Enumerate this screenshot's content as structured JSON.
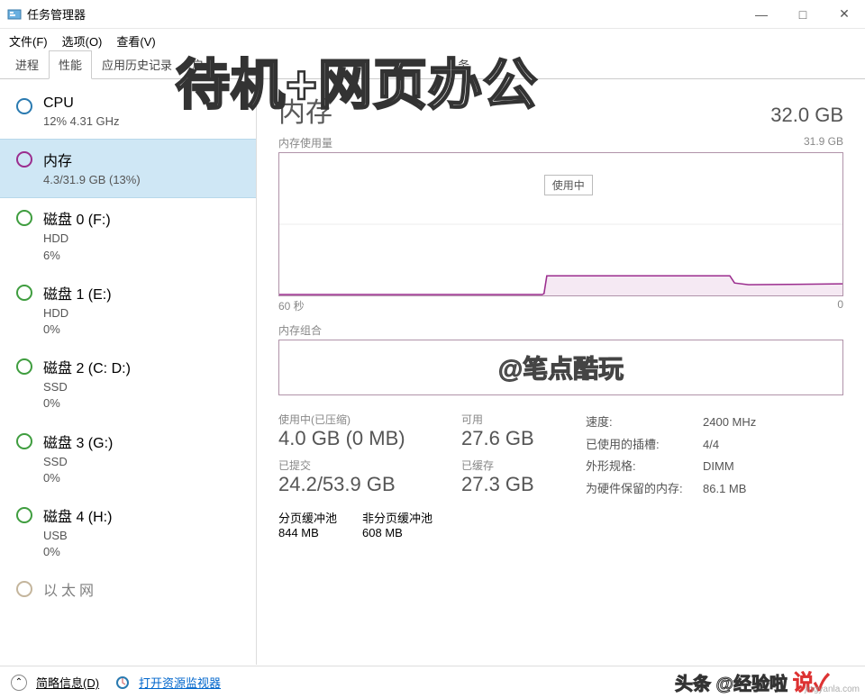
{
  "window": {
    "title": "任务管理器",
    "min": "—",
    "max": "□",
    "close": "✕"
  },
  "menu": {
    "file": "文件(F)",
    "options": "选项(O)",
    "view": "查看(V)"
  },
  "tabs": {
    "processes": "进程",
    "performance": "性能",
    "app_history": "应用历史记录",
    "startup": "启",
    "rest": "务"
  },
  "sidebar": {
    "cpu": {
      "name": "CPU",
      "sub": "12%  4.31 GHz"
    },
    "memory": {
      "name": "内存",
      "sub": "4.3/31.9 GB (13%)"
    },
    "disk0": {
      "name": "磁盘 0 (F:)",
      "sub1": "HDD",
      "sub2": "6%"
    },
    "disk1": {
      "name": "磁盘 1 (E:)",
      "sub1": "HDD",
      "sub2": "0%"
    },
    "disk2": {
      "name": "磁盘 2 (C: D:)",
      "sub1": "SSD",
      "sub2": "0%"
    },
    "disk3": {
      "name": "磁盘 3 (G:)",
      "sub1": "SSD",
      "sub2": "0%"
    },
    "disk4": {
      "name": "磁盘 4 (H:)",
      "sub1": "USB",
      "sub2": "0%"
    },
    "net": {
      "name": "以太网"
    }
  },
  "detail": {
    "title": "内存",
    "total": "32.0 GB",
    "usage_label": "内存使用量",
    "y_max": "31.9 GB",
    "x_left": "60 秒",
    "x_right": "0",
    "tooltip": "使用中",
    "group_label": "内存组合",
    "group_text": "@笔点酷玩",
    "inuse_label": "使用中(已压缩)",
    "inuse_val": "4.0 GB (0 MB)",
    "avail_label": "可用",
    "avail_val": "27.6 GB",
    "commit_label": "已提交",
    "commit_val": "24.2/53.9 GB",
    "cached_label": "已缓存",
    "cached_val": "27.3 GB",
    "paged_label": "分页缓冲池",
    "paged_val": "844 MB",
    "nonpaged_label": "非分页缓冲池",
    "nonpaged_val": "608 MB",
    "speed_k": "速度:",
    "speed_v": "2400 MHz",
    "slots_k": "已使用的插槽:",
    "slots_v": "4/4",
    "form_k": "外形规格:",
    "form_v": "DIMM",
    "reserved_k": "为硬件保留的内存:",
    "reserved_v": "86.1 MB"
  },
  "footer": {
    "brief": "简略信息(D)",
    "resmon": "打开资源监视器"
  },
  "overlay": {
    "headline": "待机+网页办公",
    "credit": "头条 @经验啦",
    "watermark": "jingyanla.com"
  },
  "chart_data": {
    "type": "area",
    "title": "内存使用量",
    "xlabel": "秒",
    "ylabel": "GB",
    "xlim": [
      60,
      0
    ],
    "ylim": [
      0,
      31.9
    ],
    "x": [
      60,
      55,
      50,
      45,
      40,
      35,
      30,
      28,
      26,
      24,
      22,
      20,
      18,
      16,
      14,
      12,
      10,
      8,
      6,
      5,
      4,
      3,
      2,
      1,
      0
    ],
    "values": [
      0.2,
      0.2,
      0.2,
      0.2,
      0.2,
      0.2,
      0.3,
      4.3,
      4.3,
      4.3,
      4.3,
      4.3,
      4.3,
      4.3,
      4.3,
      4.3,
      4.3,
      4.3,
      4.3,
      3.0,
      2.7,
      2.6,
      2.6,
      2.6,
      2.6
    ]
  }
}
